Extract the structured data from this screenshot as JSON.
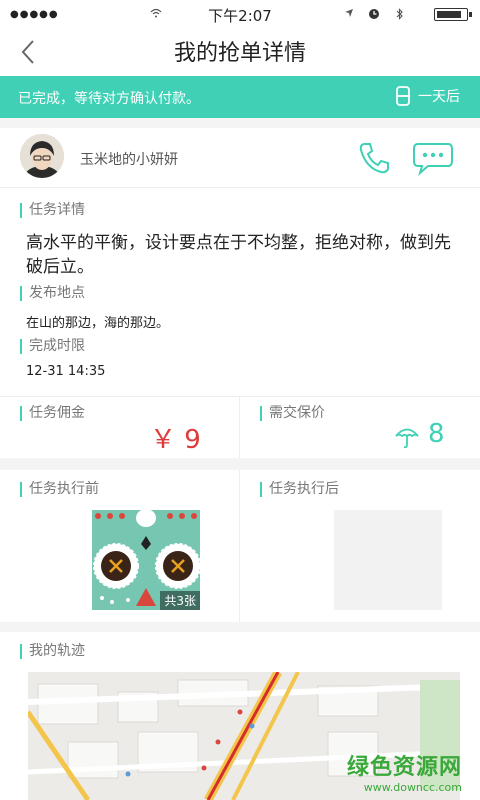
{
  "status_bar": {
    "signal": "●●●●●",
    "time": "下午2:07",
    "battery_level": 0.85
  },
  "nav": {
    "title": "我的抢单详情"
  },
  "banner": {
    "message": "已完成，等待对方确认付款。",
    "countdown": "一天后",
    "icon": "hourglass-icon"
  },
  "user": {
    "name": "玉米地的小妍妍"
  },
  "task": {
    "detail_label": "任务详情",
    "detail_text": "高水平的平衡，设计要点在于不均整，拒绝对称，做到先破后立。",
    "location_label": "发布地点",
    "location_text": "在山的那边，海的那边。",
    "deadline_label": "完成时限",
    "deadline_text": "12-31 14:35"
  },
  "payment": {
    "commission_label": "任务佣金",
    "commission_value": "￥ 9",
    "deposit_label": "需交保价",
    "deposit_value": "8",
    "commission_color": "#e03a3a",
    "deposit_color": "#3fd0b6"
  },
  "photos": {
    "before_label": "任务执行前",
    "after_label": "任务执行后",
    "count_label": "共3张"
  },
  "track": {
    "label": "我的轨迹"
  },
  "watermark": {
    "title": "绿色资源网",
    "url": "www.downcc.com"
  },
  "colors": {
    "accent": "#3fd0b6"
  }
}
